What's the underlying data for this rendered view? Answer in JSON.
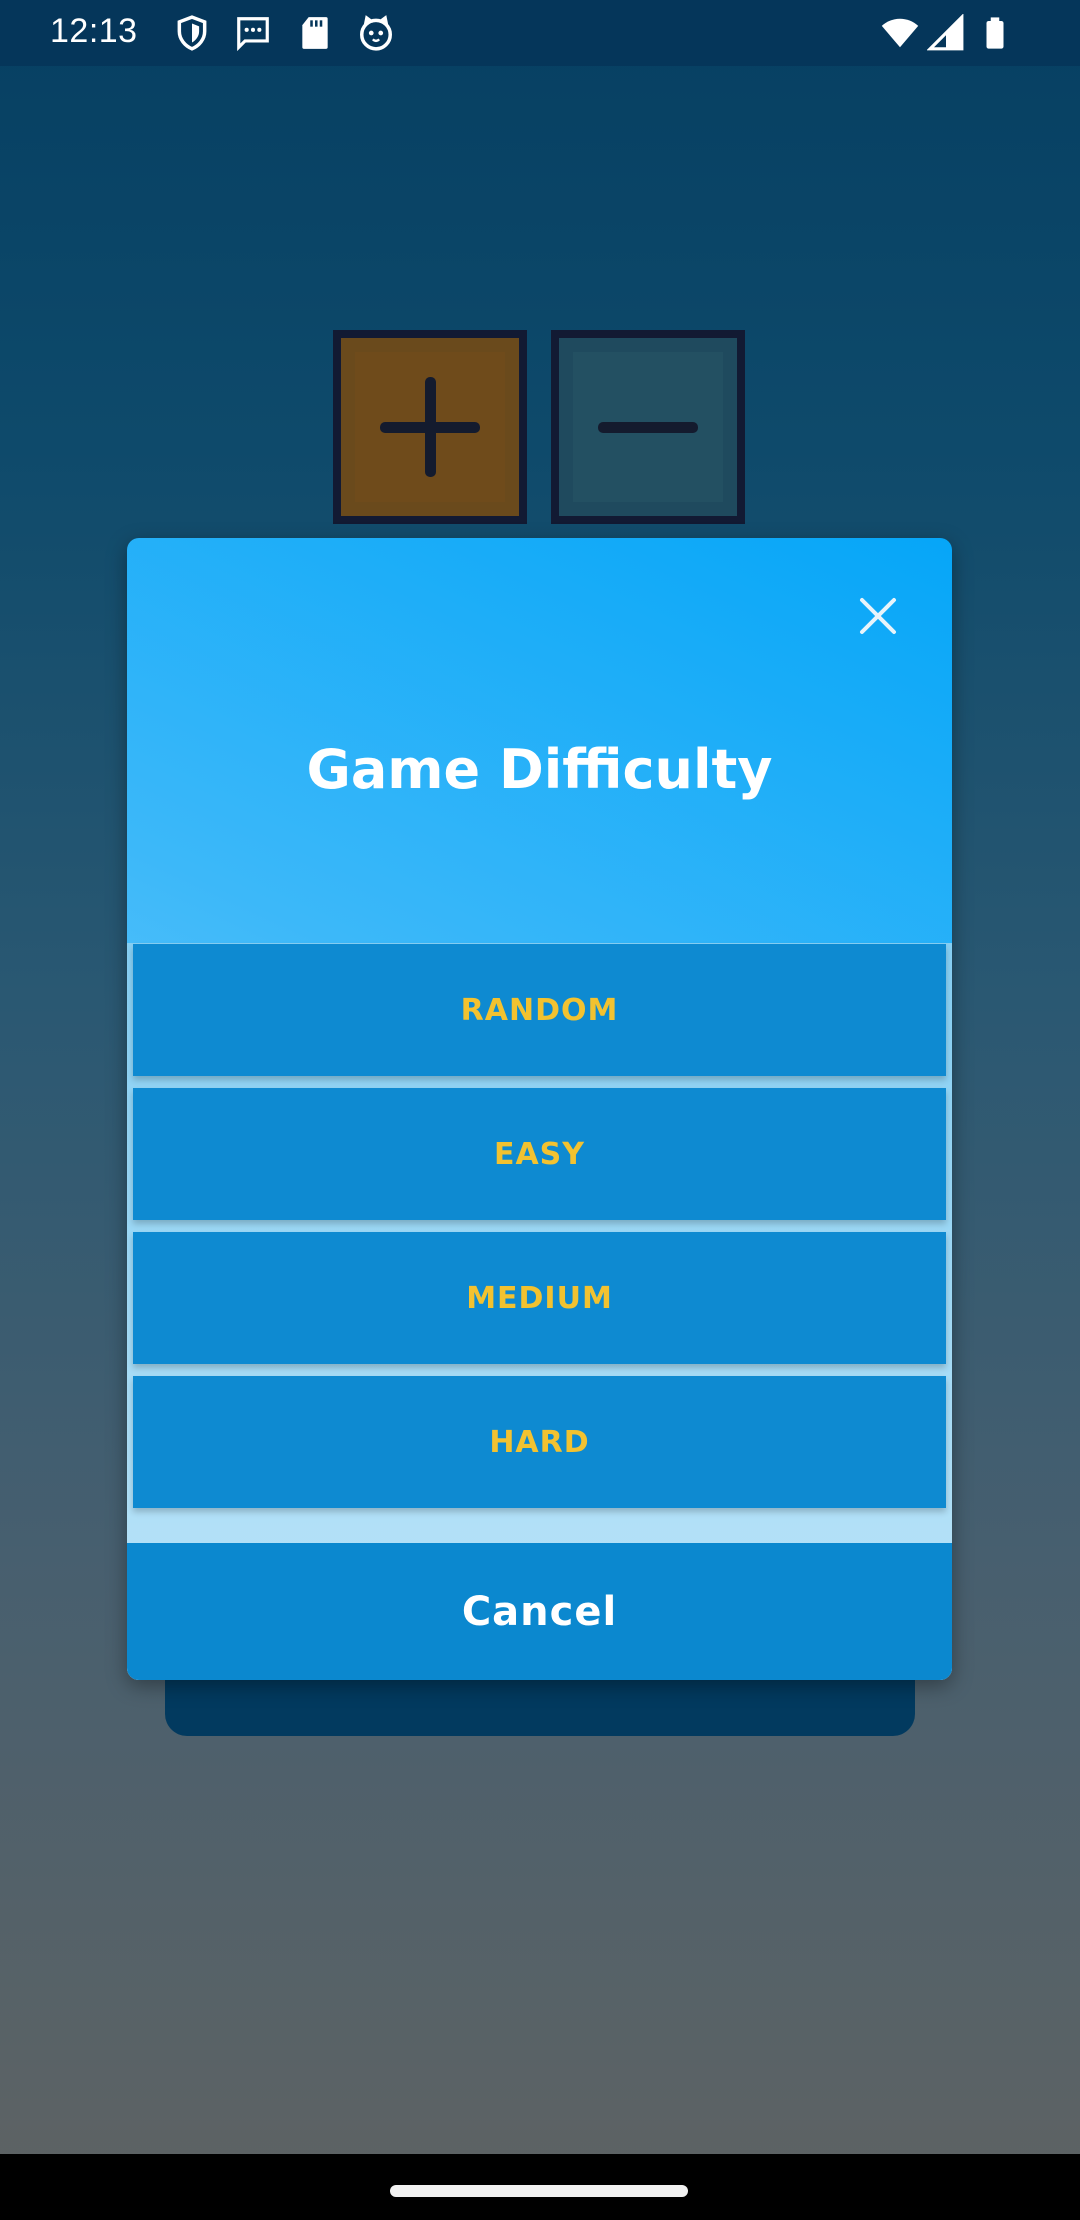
{
  "status_bar": {
    "time": "12:13",
    "left_icons": [
      "shield-icon",
      "message-icon",
      "sd-card-icon",
      "cat-icon"
    ],
    "right_icons": [
      "wifi-icon",
      "signal-icon",
      "battery-icon"
    ]
  },
  "background": {
    "tiles": [
      {
        "name": "plus-tile",
        "symbol": "+",
        "color": "#6a4a1c"
      },
      {
        "name": "minus-tile",
        "symbol": "−",
        "color": "#1f4a5e"
      }
    ]
  },
  "dialog": {
    "title": "Game Difficulty",
    "close_icon": "close-icon",
    "options": [
      "RANDOM",
      "EASY",
      "MEDIUM",
      "HARD"
    ],
    "cancel_label": "Cancel",
    "colors": {
      "option_bg": "#0e8ad1",
      "option_text": "#f2c230",
      "title_text": "#ffffff"
    }
  }
}
